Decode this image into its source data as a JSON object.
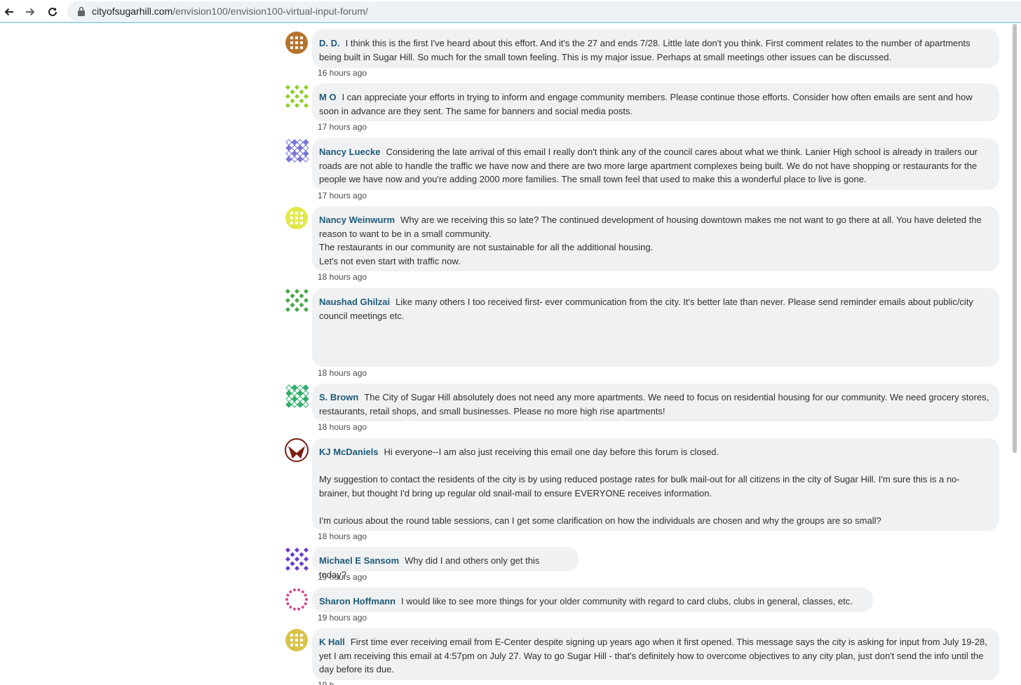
{
  "browser": {
    "url_domain": "cityofsugarhill.com",
    "url_path": "/envision100/envision100-virtual-input-forum/"
  },
  "comments": [
    {
      "name": "D. D.",
      "lines": [
        "I think this is the first I've heard about this effort. And it's the 27 and ends 7/28. Little late don't you think. First comment relates to the number of apartments being built in Sugar Hill. So much for the small town feeling. This is my major issue. Perhaps at small meetings other issues can be discussed."
      ],
      "time": "16 hours ago",
      "avatar_color": "#b5732b"
    },
    {
      "name": "M O",
      "lines": [
        "I can appreciate your efforts in trying to inform and engage community members. Please continue those efforts. Consider how often emails are sent and how soon in advance are they sent. The same for banners and social media posts."
      ],
      "time": "17 hours ago",
      "avatar_color": "#8fcf2a"
    },
    {
      "name": "Nancy Luecke",
      "lines": [
        "Considering the late arrival of this email I really don't think any of the council cares about what we think. Lanier High school is already in trailers our roads are not able to handle the traffic we have now and there are two more large apartment complexes being built. We do not have shopping or restaurants for the people we have now and you're adding 2000 more families. The small town feel that used to make this a wonderful place to live is gone."
      ],
      "time": "17 hours ago",
      "avatar_color": "#7a79d6"
    },
    {
      "name": "Nancy Weinwurm",
      "lines": [
        "Why are we receiving this so late? The continued development of housing downtown makes me not want to go there at all. You have deleted the reason to want to be in a small community.",
        "The restaurants in our community are not sustainable for all the additional housing.",
        "Let's not even start with traffic now."
      ],
      "time": "18 hours ago",
      "avatar_color": "#e3e84a"
    },
    {
      "name": "Naushad Ghilzai",
      "lines": [
        "Like many others I too received first- ever communication from the city. It's better late than never. Please send reminder emails about public/city council meetings etc."
      ],
      "time": "18 hours ago",
      "avatar_color": "#4aa84a"
    },
    {
      "name": "S. Brown",
      "lines": [
        "The City of Sugar Hill absolutely does not need any more apartments. We need to focus on residential housing for our community. We need grocery stores, restaurants, retail shops, and small businesses. Please no more high rise apartments!"
      ],
      "time": "18 hours ago",
      "avatar_color": "#2fae6a"
    },
    {
      "name": "KJ McDaniels",
      "lines": [
        "Hi everyone--I am also just receiving this email one day before this forum is closed.",
        "",
        "My suggestion to contact the residents of the city is by using reduced postage rates for bulk mail-out for all citizens in the city of Sugar Hill. I'm sure this is a no-brainer, but thought I'd bring up regular old snail-mail to ensure EVERYONE receives information.",
        "",
        "I'm curious about the round table sessions, can I get some clarification on how the individuals are chosen and why the groups are so small?"
      ],
      "time": "18 hours ago",
      "avatar_color": "#7a1e12"
    },
    {
      "name": "Michael E Sansom",
      "lines": [
        "Why did I and others only get this today?"
      ],
      "time": "19 hours ago",
      "avatar_color": "#6a3fc8"
    },
    {
      "name": "Sharon Hoffmann",
      "lines": [
        "I would like to see more things for your older community with regard to card clubs, clubs in general, classes, etc."
      ],
      "time": "19 hours ago",
      "avatar_color": "#d9458f"
    },
    {
      "name": "K Hall",
      "lines": [
        "First time ever receiving email from E-Center despite signing up years ago when it first opened. This message says the city is asking for input from July 19-28, yet I am receiving this email at 4:57pm on July 27. Way to go Sugar Hill - that's definitely how to overcome objectives to any city plan, just don't send the info until the day before its due."
      ],
      "time": "",
      "avatar_color": "#d9c44a"
    }
  ],
  "partial_time": "19 h"
}
